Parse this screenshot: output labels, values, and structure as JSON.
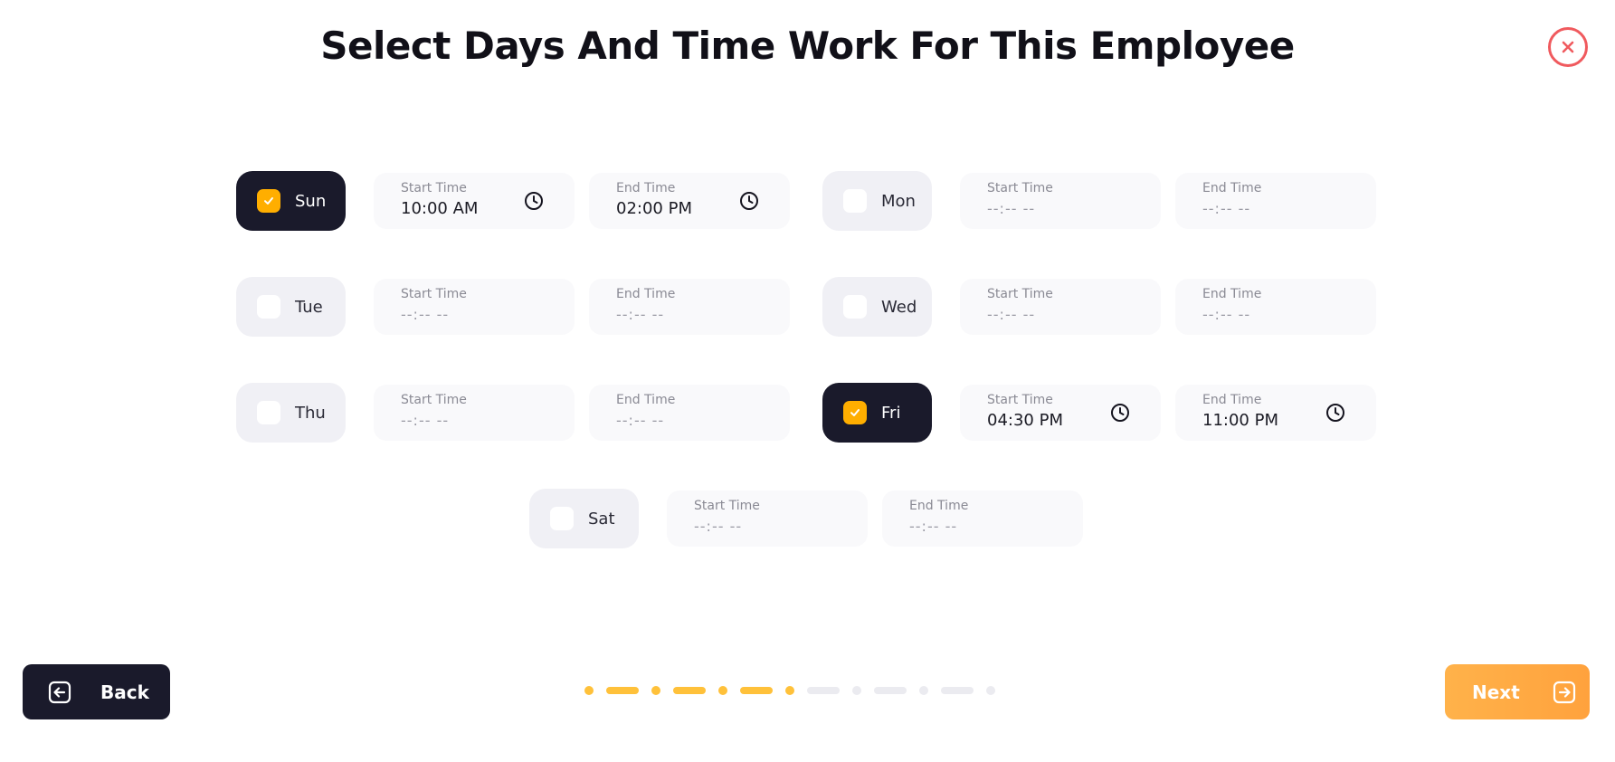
{
  "title": "Select Days And Time Work For This Employee",
  "colors": {
    "accent": "#ffae00",
    "dark": "#1a1a2b",
    "close": "#f05a5e",
    "next": "#ffa23d"
  },
  "labels": {
    "start": "Start Time",
    "end": "End Time"
  },
  "placeholder": "--:-- --",
  "days": [
    {
      "label": "Sun",
      "checked": true,
      "start": "10:00 AM",
      "end": "02:00 PM"
    },
    {
      "label": "Mon",
      "checked": false,
      "start": "--:-- --",
      "end": "--:-- --"
    },
    {
      "label": "Tue",
      "checked": false,
      "start": "--:-- --",
      "end": "--:-- --"
    },
    {
      "label": "Wed",
      "checked": false,
      "start": "--:-- --",
      "end": "--:-- --"
    },
    {
      "label": "Thu",
      "checked": false,
      "start": "--:-- --",
      "end": "--:-- --"
    },
    {
      "label": "Fri",
      "checked": true,
      "start": "04:30 PM",
      "end": "11:00 PM"
    },
    {
      "label": "Sat",
      "checked": false,
      "start": "--:-- --",
      "end": "--:-- --"
    }
  ],
  "nav": {
    "back": "Back",
    "next": "Next"
  },
  "steps": {
    "total": 13,
    "completed": 7
  },
  "icons": {
    "close": "close-icon",
    "back": "back-arrow-icon",
    "next": "next-arrow-icon",
    "clock": "clock-icon",
    "check": "check-icon"
  }
}
